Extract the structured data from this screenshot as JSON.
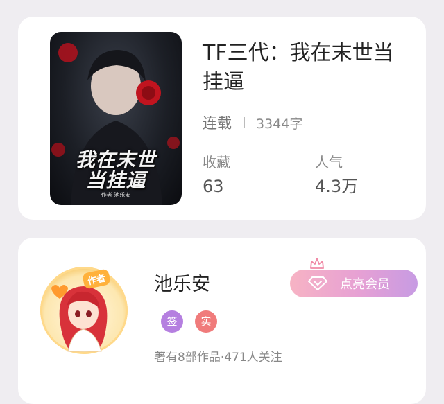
{
  "book": {
    "title": "TF三代：我在末世当挂逼",
    "status": "连载",
    "word_count": "3344字",
    "cover": {
      "title_line1": "我在末世",
      "title_line2": "当挂逼",
      "subtitle": "作者 池乐安"
    },
    "stats": {
      "favorites_label": "收藏",
      "favorites_value": "63",
      "popularity_label": "人气",
      "popularity_value": "4.3万"
    }
  },
  "author": {
    "name": "池乐安",
    "avatar_tag": "作者",
    "badge_signed": "签",
    "badge_verified": "实",
    "description": "著有8部作品·471人关注",
    "vip_button_label": "点亮会员"
  },
  "colors": {
    "background": "#efedf1",
    "card": "#ffffff",
    "badge_signed": "#b57fe0",
    "badge_verified": "#f07b7b",
    "vip_gradient_start": "#f7b3c4",
    "vip_gradient_end": "#c79be3"
  },
  "icons": {
    "vip_icon": "diamond-icon",
    "crown_icon": "crown-icon"
  }
}
